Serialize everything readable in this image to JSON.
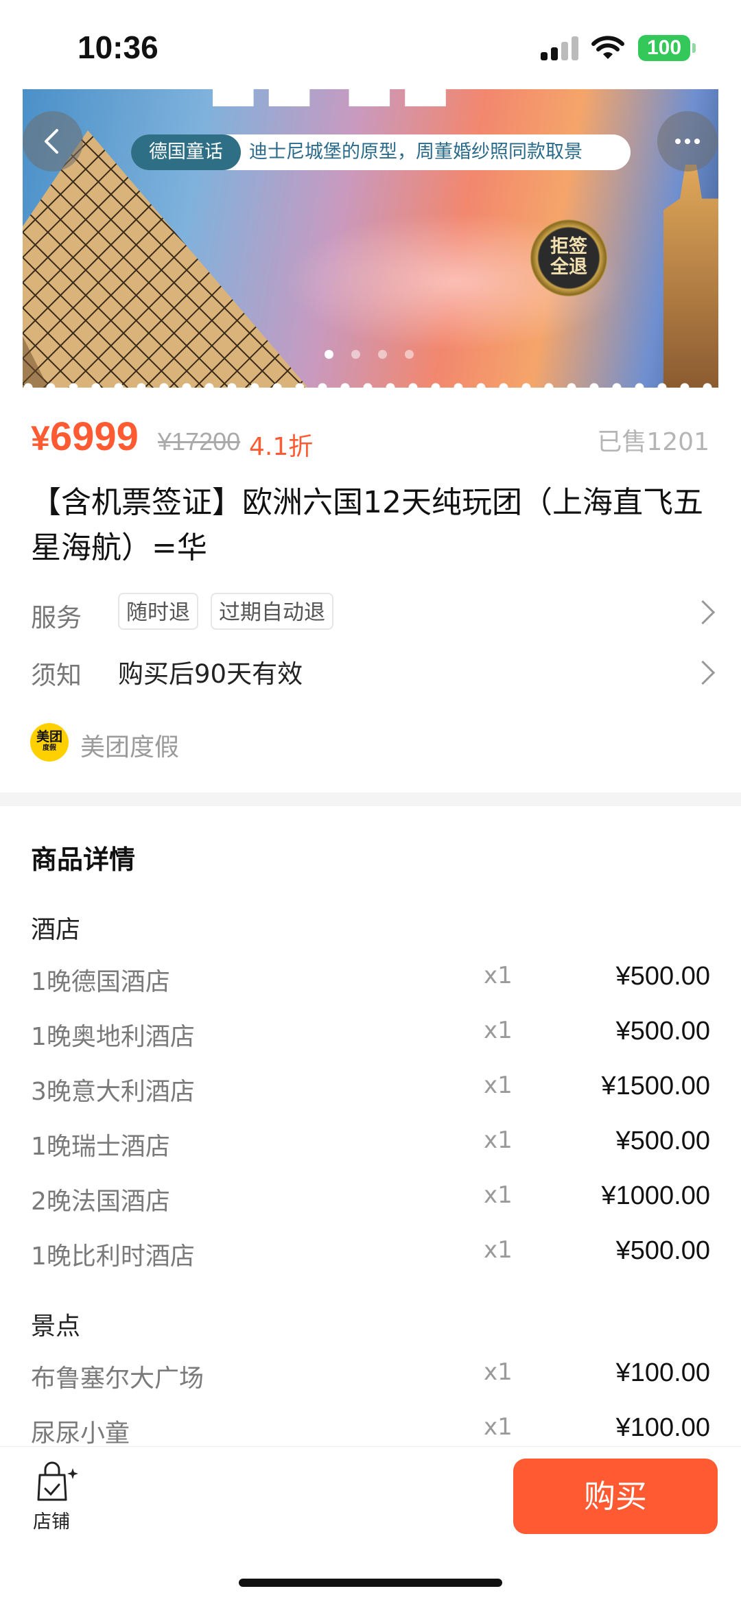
{
  "status_bar": {
    "time": "10:36",
    "battery": "100"
  },
  "banner": {
    "tag_label": "德国童话",
    "tag_text": "迪士尼城堡的原型，周董婚纱照同款取景",
    "seal_line1": "拒签",
    "seal_line2": "全退",
    "page_count": 4,
    "current_page": 1
  },
  "product": {
    "currency": "¥",
    "price": "6999",
    "original_price": "¥17200",
    "discount": "4.1折",
    "sold": "已售1201",
    "title": "【含机票签证】欧洲六国12天纯玩团（上海直飞五星海航）=华"
  },
  "service": {
    "label": "服务",
    "chips": [
      "随时退",
      "过期自动退"
    ]
  },
  "notice": {
    "label": "须知",
    "text": "购买后90天有效"
  },
  "merchant": {
    "logo_text": "美团",
    "logo_sub": "度假",
    "name": "美团度假"
  },
  "details": {
    "title": "商品详情",
    "groups": [
      {
        "title": "酒店",
        "items": [
          {
            "name": "1晚德国酒店",
            "qty": "x1",
            "amount": "¥500.00"
          },
          {
            "name": "1晚奥地利酒店",
            "qty": "x1",
            "amount": "¥500.00"
          },
          {
            "name": "3晚意大利酒店",
            "qty": "x1",
            "amount": "¥1500.00"
          },
          {
            "name": "1晚瑞士酒店",
            "qty": "x1",
            "amount": "¥500.00"
          },
          {
            "name": "2晚法国酒店",
            "qty": "x1",
            "amount": "¥1000.00"
          },
          {
            "name": "1晚比利时酒店",
            "qty": "x1",
            "amount": "¥500.00"
          }
        ]
      },
      {
        "title": "景点",
        "items": [
          {
            "name": "布鲁塞尔大广场",
            "qty": "x1",
            "amount": "¥100.00"
          },
          {
            "name": "尿尿小童",
            "qty": "x1",
            "amount": "¥100.00"
          }
        ]
      }
    ]
  },
  "bottom_bar": {
    "shop_label": "店铺",
    "buy_label": "购买"
  },
  "colors": {
    "accent": "#ff5a32",
    "tag": "#2f6f86",
    "brand_yellow": "#ffd000"
  },
  "icons": [
    "back-icon",
    "more-icon",
    "shop-bag-icon",
    "chevron-right-icon"
  ]
}
